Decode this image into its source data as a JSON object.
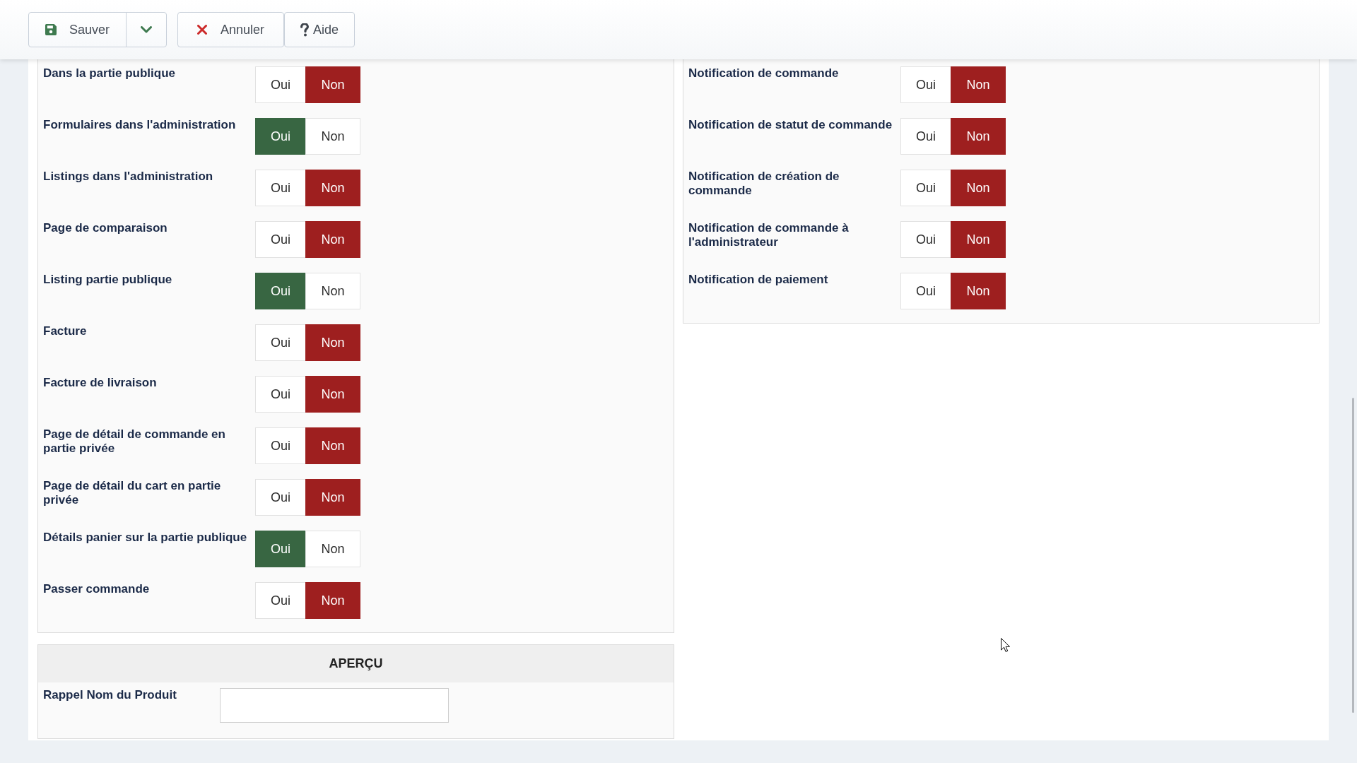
{
  "toolbar": {
    "buttons": [
      {
        "kind": "save",
        "label": "Sauver"
      },
      {
        "kind": "menu"
      },
      {
        "kind": "cancel",
        "label": "Annuler"
      },
      {
        "kind": "help",
        "label": "Aide"
      }
    ]
  },
  "left_panel": {
    "settings": [
      {
        "label": "Dans la partie publique",
        "options": [
          {
            "kind": "yes",
            "label": "Oui",
            "selected": false
          },
          {
            "kind": "no",
            "label": "Non",
            "selected": true
          }
        ]
      },
      {
        "label": "Formulaires dans l'administration",
        "options": [
          {
            "kind": "yes",
            "label": "Oui",
            "selected": true
          },
          {
            "kind": "no",
            "label": "Non",
            "selected": false
          }
        ]
      },
      {
        "label": "Listings dans l'administration",
        "options": [
          {
            "kind": "yes",
            "label": "Oui",
            "selected": false
          },
          {
            "kind": "no",
            "label": "Non",
            "selected": true
          }
        ]
      },
      {
        "label": "Page de comparaison",
        "options": [
          {
            "kind": "yes",
            "label": "Oui",
            "selected": false
          },
          {
            "kind": "no",
            "label": "Non",
            "selected": true
          }
        ]
      },
      {
        "label": "Listing partie publique",
        "options": [
          {
            "kind": "yes",
            "label": "Oui",
            "selected": true
          },
          {
            "kind": "no",
            "label": "Non",
            "selected": false
          }
        ]
      },
      {
        "label": "Facture",
        "options": [
          {
            "kind": "yes",
            "label": "Oui",
            "selected": false
          },
          {
            "kind": "no",
            "label": "Non",
            "selected": true
          }
        ]
      },
      {
        "label": "Facture de livraison",
        "options": [
          {
            "kind": "yes",
            "label": "Oui",
            "selected": false
          },
          {
            "kind": "no",
            "label": "Non",
            "selected": true
          }
        ]
      },
      {
        "label": "Page de détail de commande en partie privée",
        "options": [
          {
            "kind": "yes",
            "label": "Oui",
            "selected": false
          },
          {
            "kind": "no",
            "label": "Non",
            "selected": true
          }
        ]
      },
      {
        "label": "Page de détail du cart en partie privée",
        "options": [
          {
            "kind": "yes",
            "label": "Oui",
            "selected": false
          },
          {
            "kind": "no",
            "label": "Non",
            "selected": true
          }
        ]
      },
      {
        "label": "Détails panier sur la partie publique",
        "options": [
          {
            "kind": "yes",
            "label": "Oui",
            "selected": true
          },
          {
            "kind": "no",
            "label": "Non",
            "selected": false
          }
        ]
      },
      {
        "label": "Passer commande",
        "options": [
          {
            "kind": "yes",
            "label": "Oui",
            "selected": false
          },
          {
            "kind": "no",
            "label": "Non",
            "selected": true
          }
        ]
      }
    ]
  },
  "right_panel": {
    "settings": [
      {
        "label": "Notification de commande",
        "options": [
          {
            "kind": "yes",
            "label": "Oui",
            "selected": false
          },
          {
            "kind": "no",
            "label": "Non",
            "selected": true
          }
        ]
      },
      {
        "label": "Notification de statut de commande",
        "options": [
          {
            "kind": "yes",
            "label": "Oui",
            "selected": false
          },
          {
            "kind": "no",
            "label": "Non",
            "selected": true
          }
        ]
      },
      {
        "label": "Notification de création de commande",
        "options": [
          {
            "kind": "yes",
            "label": "Oui",
            "selected": false
          },
          {
            "kind": "no",
            "label": "Non",
            "selected": true
          }
        ]
      },
      {
        "label": "Notification de commande à l'administrateur",
        "options": [
          {
            "kind": "yes",
            "label": "Oui",
            "selected": false
          },
          {
            "kind": "no",
            "label": "Non",
            "selected": true
          }
        ]
      },
      {
        "label": "Notification de paiement",
        "options": [
          {
            "kind": "yes",
            "label": "Oui",
            "selected": false
          },
          {
            "kind": "no",
            "label": "Non",
            "selected": true
          }
        ]
      }
    ]
  },
  "preview": {
    "title": "APERÇU",
    "fields": [
      {
        "label": "Rappel Nom du Produit"
      }
    ]
  }
}
